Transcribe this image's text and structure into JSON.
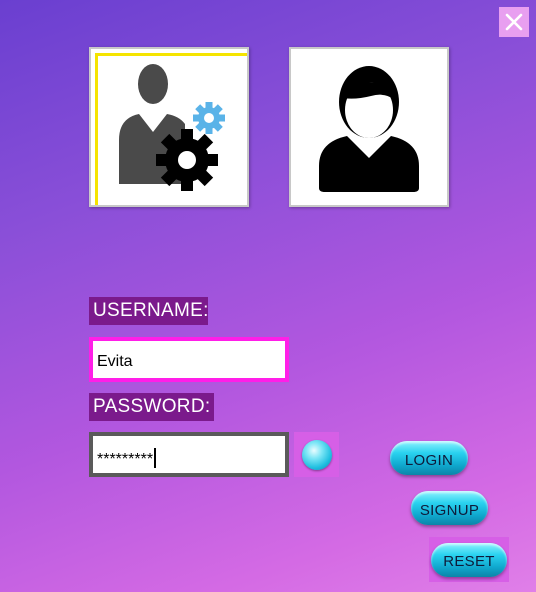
{
  "window": {
    "close_icon": "close-icon"
  },
  "roles": [
    {
      "name": "admin",
      "icon": "admin-gear-icon",
      "selected": true
    },
    {
      "name": "user",
      "icon": "user-avatar-icon",
      "selected": false
    }
  ],
  "form": {
    "username_label": "USERNAME:",
    "username_value": "Evita",
    "password_label": "PASSWORD:",
    "password_value": "*********",
    "show_password_icon": "eye-orb-icon"
  },
  "buttons": {
    "login": "LOGIN",
    "signup": "SIGNUP",
    "reset": "RESET"
  },
  "colors": {
    "accent_magenta": "#ff1ee8",
    "label_bg": "#7b1a8c",
    "button_cyan": "#2ad2ef",
    "selected_border": "#f5e400"
  }
}
